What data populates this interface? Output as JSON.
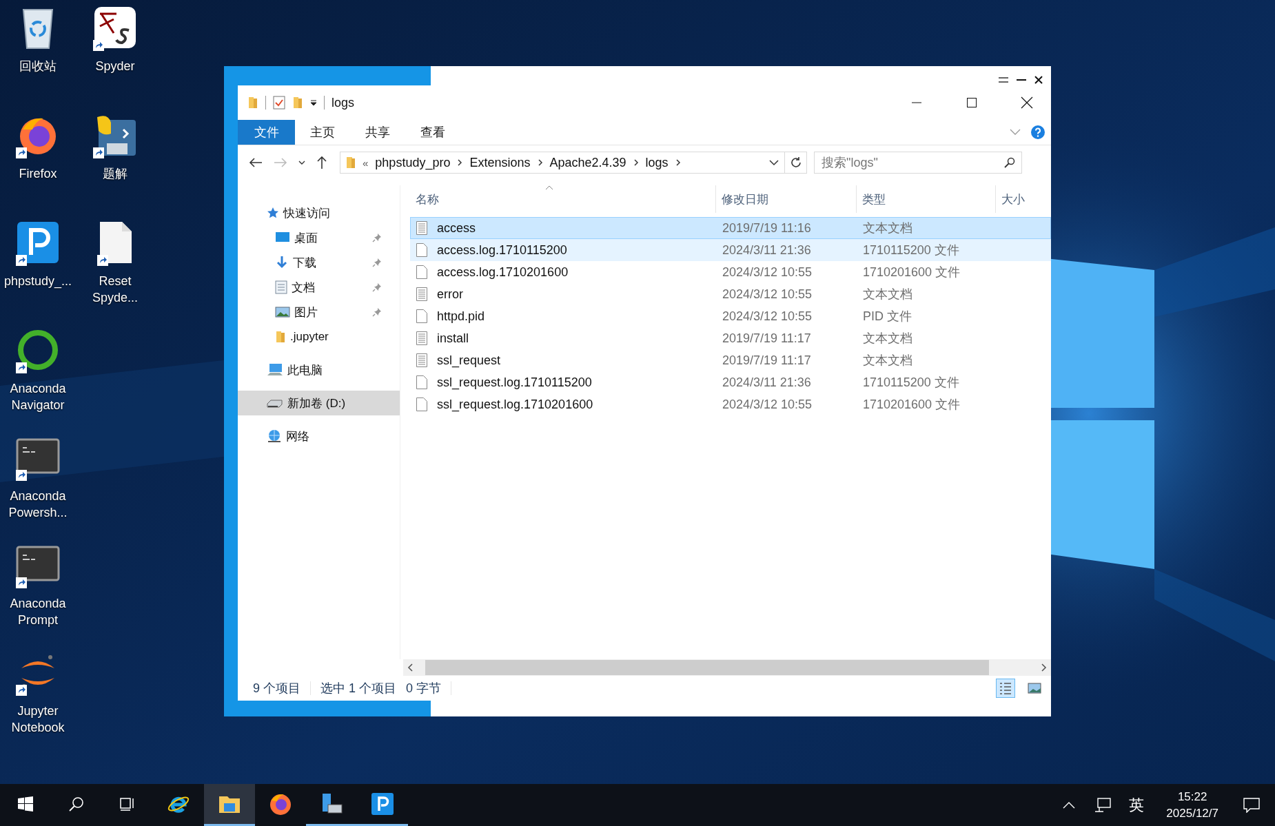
{
  "desktop_icons": [
    {
      "label": "回收站",
      "kind": "recycle",
      "shortcut": false
    },
    {
      "label": "Firefox",
      "kind": "firefox",
      "shortcut": true
    },
    {
      "label": "phpstudy_...",
      "kind": "phpstudy",
      "shortcut": true
    },
    {
      "label": "Anaconda Navigator",
      "kind": "anaconda",
      "shortcut": true
    },
    {
      "label": "Anaconda Powersh...",
      "kind": "terminal",
      "shortcut": true
    },
    {
      "label": "Anaconda Prompt",
      "kind": "terminal",
      "shortcut": true
    },
    {
      "label": "Jupyter Notebook",
      "kind": "jupyter",
      "shortcut": true
    },
    {
      "label": "Spyder",
      "kind": "spyder",
      "shortcut": true
    },
    {
      "label": "题解",
      "kind": "python",
      "shortcut": true
    },
    {
      "label": "Reset Spyde...",
      "kind": "file",
      "shortcut": true
    }
  ],
  "explorer": {
    "title": "logs",
    "ribbon_tabs": [
      {
        "label": "文件",
        "selected": true
      },
      {
        "label": "主页",
        "selected": false
      },
      {
        "label": "共享",
        "selected": false
      },
      {
        "label": "查看",
        "selected": false
      }
    ],
    "address": {
      "overflow": "«",
      "crumbs": [
        "phpstudy_pro",
        "Extensions",
        "Apache2.4.39",
        "logs"
      ]
    },
    "search": {
      "placeholder": "搜索\"logs\""
    },
    "nav": [
      {
        "label": "快速访问",
        "kind": "star",
        "selected": false,
        "children": [
          {
            "label": "桌面",
            "kind": "desktop",
            "pinned": true,
            "selected": false
          },
          {
            "label": "下载",
            "kind": "download",
            "pinned": true,
            "selected": false
          },
          {
            "label": "文档",
            "kind": "document",
            "pinned": true,
            "selected": false
          },
          {
            "label": "图片",
            "kind": "pictures",
            "pinned": true,
            "selected": false
          },
          {
            "label": ".jupyter",
            "kind": "folder",
            "pinned": false,
            "selected": false
          }
        ]
      },
      {
        "label": "此电脑",
        "kind": "computer",
        "selected": false
      },
      {
        "label": "新加卷 (D:)",
        "kind": "drive",
        "selected": true
      },
      {
        "label": "网络",
        "kind": "network",
        "selected": false
      }
    ],
    "columns": [
      "名称",
      "修改日期",
      "类型",
      "大小"
    ],
    "files": [
      {
        "name": "access",
        "modified": "2019/7/19 11:16",
        "type": "文本文档",
        "kind": "text",
        "selected": true,
        "hovered": false
      },
      {
        "name": "access.log.1710115200",
        "modified": "2024/3/11 21:36",
        "type": "1710115200 文件",
        "kind": "blank",
        "selected": false,
        "hovered": true
      },
      {
        "name": "access.log.1710201600",
        "modified": "2024/3/12 10:55",
        "type": "1710201600 文件",
        "kind": "blank",
        "selected": false,
        "hovered": false
      },
      {
        "name": "error",
        "modified": "2024/3/12 10:55",
        "type": "文本文档",
        "kind": "text",
        "selected": false,
        "hovered": false
      },
      {
        "name": "httpd.pid",
        "modified": "2024/3/12 10:55",
        "type": "PID 文件",
        "kind": "blank",
        "selected": false,
        "hovered": false
      },
      {
        "name": "install",
        "modified": "2019/7/19 11:17",
        "type": "文本文档",
        "kind": "text",
        "selected": false,
        "hovered": false
      },
      {
        "name": "ssl_request",
        "modified": "2019/7/19 11:17",
        "type": "文本文档",
        "kind": "text",
        "selected": false,
        "hovered": false
      },
      {
        "name": "ssl_request.log.1710115200",
        "modified": "2024/3/11 21:36",
        "type": "1710115200 文件",
        "kind": "blank",
        "selected": false,
        "hovered": false
      },
      {
        "name": "ssl_request.log.1710201600",
        "modified": "2024/3/12 10:55",
        "type": "1710201600 文件",
        "kind": "blank",
        "selected": false,
        "hovered": false
      }
    ],
    "status": {
      "count": "9 个项目",
      "selection": "选中 1 个项目",
      "size": "0 字节"
    },
    "view_modes": [
      {
        "kind": "details",
        "selected": true
      },
      {
        "kind": "thumbnails",
        "selected": false
      }
    ]
  },
  "taskbar": {
    "items": [
      {
        "kind": "start",
        "running": false,
        "active": false
      },
      {
        "kind": "search",
        "running": false,
        "active": false
      },
      {
        "kind": "taskview",
        "running": false,
        "active": false
      },
      {
        "kind": "ie",
        "running": false,
        "active": false
      },
      {
        "kind": "explorer",
        "running": true,
        "active": true
      },
      {
        "kind": "firefox",
        "running": false,
        "active": false
      },
      {
        "kind": "server",
        "running": true,
        "active": false
      },
      {
        "kind": "phpstudy",
        "running": true,
        "active": false
      }
    ],
    "tray": {
      "ime": "英",
      "time": "15:22",
      "date": "2025/12/7"
    }
  }
}
